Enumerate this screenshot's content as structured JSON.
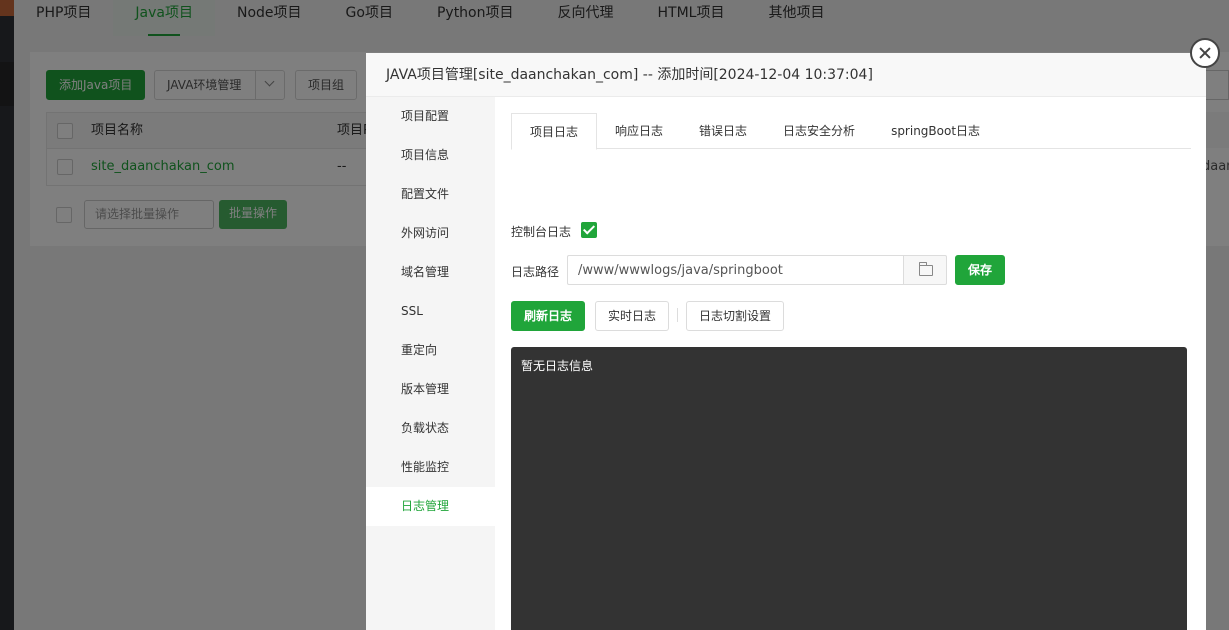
{
  "background": {
    "type_tabs": [
      {
        "label": "PHP项目",
        "active": false
      },
      {
        "label": "Java项目",
        "active": true
      },
      {
        "label": "Node项目",
        "active": false
      },
      {
        "label": "Go项目",
        "active": false
      },
      {
        "label": "Python项目",
        "active": false
      },
      {
        "label": "反向代理",
        "active": false
      },
      {
        "label": "HTML项目",
        "active": false
      },
      {
        "label": "其他项目",
        "active": false
      }
    ],
    "add_button": "添加Java项目",
    "env_button": "JAVA环境管理",
    "group_button": "项目组",
    "table": {
      "header_name": "项目名称",
      "header_col2": "项目P",
      "row_name": "site_daanchakan_com",
      "row_col2": "--",
      "row_right": "daan"
    },
    "bulk_select_placeholder": "请选择批量操作",
    "bulk_button": "批量操作"
  },
  "modal": {
    "title": "JAVA项目管理[site_daanchakan_com] -- 添加时间[2024-12-04 10:37:04]",
    "side_nav": [
      {
        "label": "项目配置",
        "active": false
      },
      {
        "label": "项目信息",
        "active": false
      },
      {
        "label": "配置文件",
        "active": false
      },
      {
        "label": "外网访问",
        "active": false
      },
      {
        "label": "域名管理",
        "active": false
      },
      {
        "label": "SSL",
        "active": false
      },
      {
        "label": "重定向",
        "active": false
      },
      {
        "label": "版本管理",
        "active": false
      },
      {
        "label": "负载状态",
        "active": false
      },
      {
        "label": "性能监控",
        "active": false
      },
      {
        "label": "日志管理",
        "active": true
      }
    ],
    "tabs": [
      {
        "label": "项目日志",
        "active": true
      },
      {
        "label": "响应日志",
        "active": false
      },
      {
        "label": "错误日志",
        "active": false
      },
      {
        "label": "日志安全分析",
        "active": false
      },
      {
        "label": "springBoot日志",
        "active": false
      }
    ],
    "console_log_label": "控制台日志",
    "console_log_checked": true,
    "log_path_label": "日志路径",
    "log_path_value": "/www/wwwlogs/java/springboot",
    "save_button": "保存",
    "refresh_button": "刷新日志",
    "realtime_button": "实时日志",
    "split_button": "日志切割设置",
    "log_content": "暂无日志信息"
  },
  "colors": {
    "accent": "#20a53a",
    "log_bg": "#333333"
  }
}
